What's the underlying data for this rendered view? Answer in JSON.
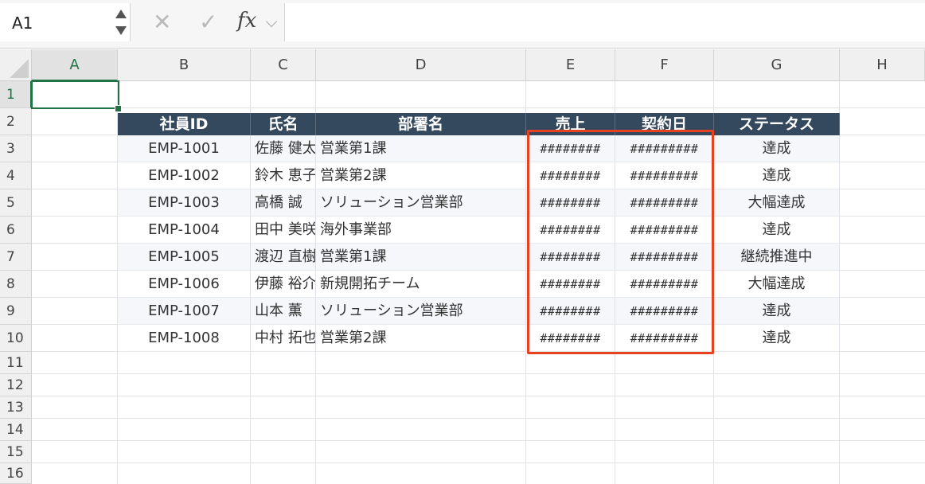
{
  "formula_bar": {
    "name_box": "A1",
    "cancel_symbol": "✕",
    "enter_symbol": "✓",
    "fx_label": "fx",
    "formula": ""
  },
  "columns": [
    "A",
    "B",
    "C",
    "D",
    "E",
    "F",
    "G",
    "H"
  ],
  "rows": [
    "1",
    "2",
    "3",
    "4",
    "5",
    "6",
    "7",
    "8",
    "9",
    "10",
    "11",
    "12",
    "13",
    "14",
    "15",
    "16"
  ],
  "table": {
    "headers": [
      "社員ID",
      "氏名",
      "部署名",
      "売上",
      "契約日",
      "ステータス"
    ],
    "rows": [
      {
        "id": "EMP-1001",
        "name": "佐藤 健太",
        "dept": "営業第1課",
        "sales": "########",
        "date": "#########",
        "status": "達成"
      },
      {
        "id": "EMP-1002",
        "name": "鈴木 恵子",
        "dept": "営業第2課",
        "sales": "########",
        "date": "#########",
        "status": "達成"
      },
      {
        "id": "EMP-1003",
        "name": "高橋 誠",
        "dept": "ソリューション営業部",
        "sales": "########",
        "date": "#########",
        "status": "大幅達成"
      },
      {
        "id": "EMP-1004",
        "name": "田中 美咲",
        "dept": "海外事業部",
        "sales": "########",
        "date": "#########",
        "status": "達成"
      },
      {
        "id": "EMP-1005",
        "name": "渡辺 直樹",
        "dept": "営業第1課",
        "sales": "########",
        "date": "#########",
        "status": "継続推進中"
      },
      {
        "id": "EMP-1006",
        "name": "伊藤 裕介",
        "dept": "新規開拓チーム",
        "sales": "########",
        "date": "#########",
        "status": "大幅達成"
      },
      {
        "id": "EMP-1007",
        "name": "山本 薫",
        "dept": "ソリューション営業部",
        "sales": "########",
        "date": "#########",
        "status": "達成"
      },
      {
        "id": "EMP-1008",
        "name": "中村 拓也",
        "dept": "営業第2課",
        "sales": "########",
        "date": "#########",
        "status": "達成"
      }
    ]
  },
  "colors": {
    "header_fill": "#34495e",
    "selection": "#217346",
    "highlight": "#e8411f"
  }
}
